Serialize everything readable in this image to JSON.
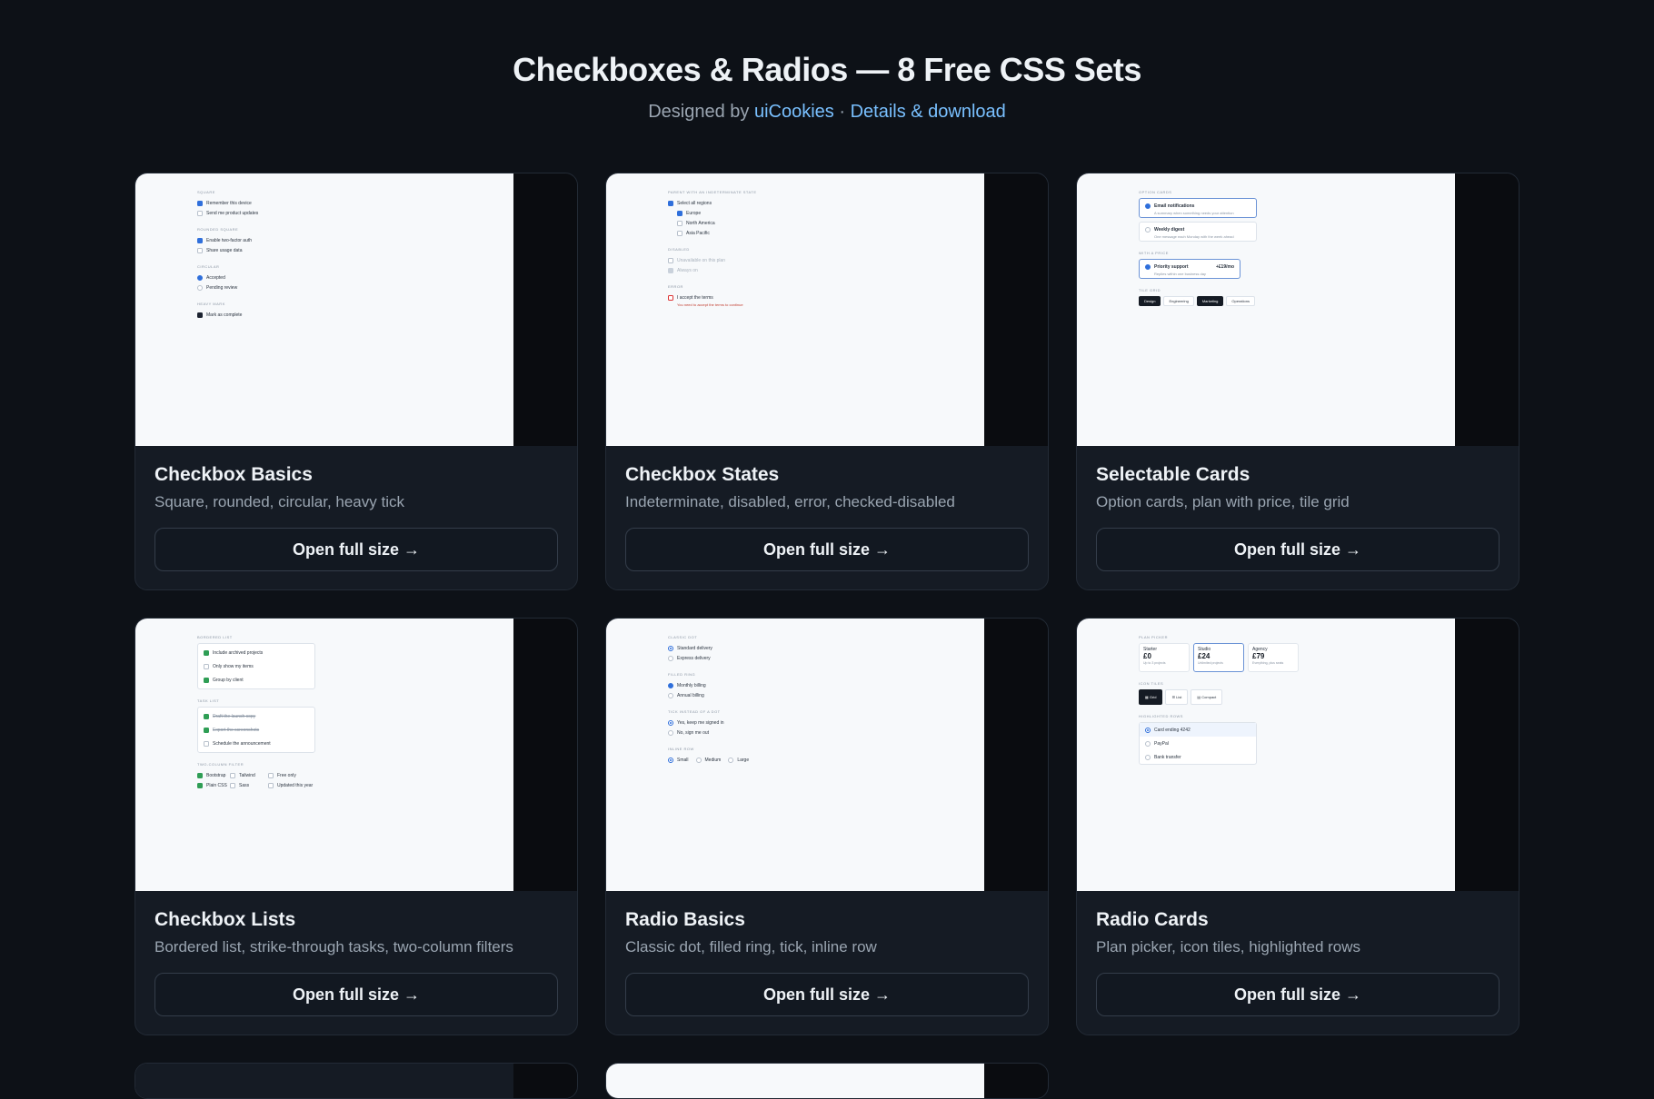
{
  "header": {
    "title": "Checkboxes & Radios — 8 Free CSS Sets",
    "designed_by": "Designed by",
    "author_link": "uiCookies",
    "separator": "·",
    "details_link": "Details & download"
  },
  "cards": [
    {
      "title": "Checkbox Basics",
      "description": "Square, rounded, circular, heavy tick",
      "button": "Open full size →",
      "preview": {
        "sections": [
          {
            "label": "Square",
            "items": [
              "Remember this device",
              "Send me product updates"
            ]
          },
          {
            "label": "Rounded square",
            "items": [
              "Enable two-factor auth",
              "Share usage data"
            ]
          },
          {
            "label": "Circular",
            "items": [
              "Accepted",
              "Pending review"
            ]
          },
          {
            "label": "Heavy mark",
            "items": [
              "Mark as complete"
            ]
          }
        ]
      }
    },
    {
      "title": "Checkbox States",
      "description": "Indeterminate, disabled, error, checked-disabled",
      "button": "Open full size →",
      "preview": {
        "sections": [
          {
            "label": "Parent with an indeterminate state",
            "items": [
              "Select all regions",
              "Europe",
              "North America",
              "Asia Pacific"
            ]
          },
          {
            "label": "Disabled",
            "items": [
              "Unavailable on this plan",
              "Always on"
            ]
          },
          {
            "label": "Error",
            "items": [
              "I accept the terms"
            ]
          }
        ],
        "error_text": "You need to accept the terms to continue"
      }
    },
    {
      "title": "Selectable Cards",
      "description": "Option cards, plan with price, tile grid",
      "button": "Open full size →",
      "preview": {
        "sec1": "Option cards",
        "opt1_title": "Email notifications",
        "opt1_desc": "A summary when something needs your attention",
        "opt2_title": "Weekly digest",
        "opt2_desc": "One message each Monday with the week ahead",
        "sec2": "With a price",
        "plan_title": "Priority support",
        "plan_price": "+£19/mo",
        "plan_desc": "Replies within one business day",
        "sec3": "Tile grid",
        "tiles": [
          "Design",
          "Engineering",
          "Marketing",
          "Operations"
        ]
      }
    },
    {
      "title": "Checkbox Lists",
      "description": "Bordered list, strike-through tasks, two-column filters",
      "button": "Open full size →",
      "preview": {
        "sections": [
          {
            "label": "Bordered list",
            "items": [
              "Include archived projects",
              "Only show my items",
              "Group by client"
            ]
          },
          {
            "label": "Task list",
            "items": [
              "Draft the launch copy",
              "Export the screenshots",
              "Schedule the announcement"
            ]
          }
        ],
        "filters_label": "Two-column filter",
        "filters": [
          "Bootstrap",
          "Tailwind",
          "Free only",
          "Plain CSS",
          "Sass",
          "Updated this year"
        ]
      }
    },
    {
      "title": "Radio Basics",
      "description": "Classic dot, filled ring, tick, inline row",
      "button": "Open full size →",
      "preview": {
        "sections": [
          {
            "label": "Classic dot",
            "items": [
              "Standard delivery",
              "Express delivery"
            ]
          },
          {
            "label": "Filled ring",
            "items": [
              "Monthly billing",
              "Annual billing"
            ]
          },
          {
            "label": "Tick instead of a dot",
            "items": [
              "Yes, keep me signed in",
              "No, sign me out"
            ]
          }
        ],
        "inline_label": "Inline row",
        "inline_items": [
          "Small",
          "Medium",
          "Large"
        ]
      }
    },
    {
      "title": "Radio Cards",
      "description": "Plan picker, icon tiles, highlighted rows",
      "button": "Open full size →",
      "preview": {
        "sec1": "Plan picker",
        "plans": [
          {
            "name": "Starter",
            "price": "£0",
            "note": "Up to 3 projects"
          },
          {
            "name": "Studio",
            "price": "£24",
            "note": "Unlimited projects"
          },
          {
            "name": "Agency",
            "price": "£79",
            "note": "Everything, plus seats"
          }
        ],
        "sec2": "Icon tiles",
        "tiles": [
          "Grid",
          "List",
          "Compact"
        ],
        "sec3": "Highlighted rows",
        "rows": [
          "Card ending 4242",
          "PayPal",
          "Bank transfer"
        ]
      }
    }
  ]
}
